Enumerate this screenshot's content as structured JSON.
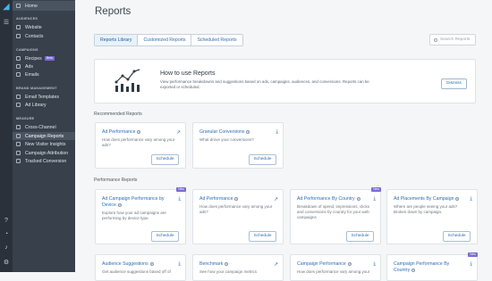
{
  "sidebar": {
    "home": "Home",
    "sections": [
      {
        "title": "AUDIENCES",
        "items": [
          "Website",
          "Contacts"
        ]
      },
      {
        "title": "CAMPAIGNS",
        "items": [
          "Recipes",
          "Ads",
          "Emails"
        ]
      },
      {
        "title": "BRAND MANAGEMENT",
        "items": [
          "Email Templates",
          "Ad Library"
        ]
      },
      {
        "title": "MEASURE",
        "items": [
          "Cross-Channel",
          "Campaign Reports",
          "New Visitor Insights",
          "Campaign Attribution",
          "Tracked Conversion"
        ]
      }
    ],
    "recipes_badge": "Beta",
    "active_item": "Campaign Reports"
  },
  "header": {
    "title": "Reports"
  },
  "tabs": [
    "Reports Library",
    "Customized Reports",
    "Scheduled Reports"
  ],
  "search": {
    "placeholder": "Search Reports"
  },
  "howto": {
    "title": "How to use Reports",
    "desc": "View performance breakdowns and suggestions based on ads, campaigns, audiences, and conversions. Reports can be exported or scheduled.",
    "dismiss": "Dismiss"
  },
  "recommended": {
    "title": "Recommended Reports",
    "cards": [
      {
        "title": "Ad Performance",
        "desc": "How does performance vary among your ads?",
        "action": "Schedule"
      },
      {
        "title": "Granular Conversions",
        "desc": "What drove your conversions?",
        "action": "Schedule"
      }
    ]
  },
  "performance": {
    "title": "Performance Reports",
    "cards": [
      {
        "title": "Ad Campaign Performance by Device",
        "desc": "Explore how your ad campaigns are performing by device type.",
        "action": "Schedule",
        "badge": "New"
      },
      {
        "title": "Ad Performance",
        "desc": "How does performance vary among your ads?",
        "action": "Schedule"
      },
      {
        "title": "Ad Performance By Country",
        "desc": "Breakdown of spend, impressions, clicks and conversions by country for your web campaigns",
        "action": "Schedule",
        "badge": "New"
      },
      {
        "title": "Ad Placements By Campaign",
        "desc": "Where are people seeing your ads? Broken down by campaign.",
        "action": "Schedule"
      },
      {
        "title": "Audience Suggestions",
        "desc": "Get audience suggestions based off of"
      },
      {
        "title": "Benchmark",
        "desc": "See how your campaign metrics"
      },
      {
        "title": "Campaign Performance",
        "desc": "How does performance vary among your"
      },
      {
        "title": "Campaign Performance By Country",
        "desc": "",
        "badge": "New"
      }
    ]
  }
}
